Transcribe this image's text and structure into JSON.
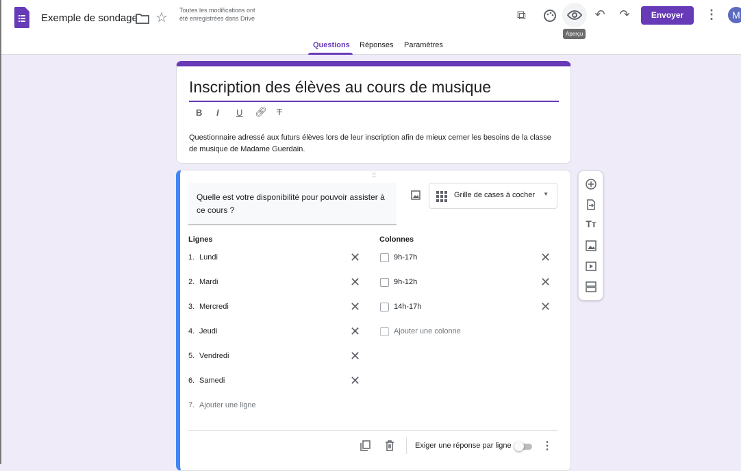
{
  "header": {
    "doc_title": "Exemple de sondage",
    "save_status": "Toutes les modifications ont été enregistrées dans Drive",
    "send_label": "Envoyer",
    "avatar_letter": "M",
    "tooltip": "Aperçu"
  },
  "tabs": [
    {
      "label": "Questions",
      "active": true
    },
    {
      "label": "Réponses"
    },
    {
      "label": "Paramètres"
    }
  ],
  "form": {
    "title": "Inscription des élèves au cours de musique",
    "description": "Questionnaire adressé aux futurs élèves lors de leur inscription afin de mieux cerner les besoins de la classe de musique de Madame Guerdain."
  },
  "question": {
    "text": "Quelle est votre disponibilité pour pouvoir assister à ce cours ?",
    "type": "Grille de cases à cocher",
    "rows_label": "Lignes",
    "cols_label": "Colonnes",
    "rows": [
      {
        "n": "1.",
        "label": "Lundi"
      },
      {
        "n": "2.",
        "label": "Mardi"
      },
      {
        "n": "3.",
        "label": "Mercredi"
      },
      {
        "n": "4.",
        "label": "Jeudi"
      },
      {
        "n": "5.",
        "label": "Vendredi"
      },
      {
        "n": "6.",
        "label": "Samedi"
      }
    ],
    "add_row_n": "7.",
    "add_row": "Ajouter une ligne",
    "cols": [
      "9h-17h",
      "9h-12h",
      "14h-17h"
    ],
    "add_col": "Ajouter une colonne",
    "require_label": "Exiger une réponse par ligne",
    "require_on": false
  },
  "colors": {
    "accent": "#673ab7",
    "blue": "#4285f4",
    "bg": "#f0ebf8"
  }
}
